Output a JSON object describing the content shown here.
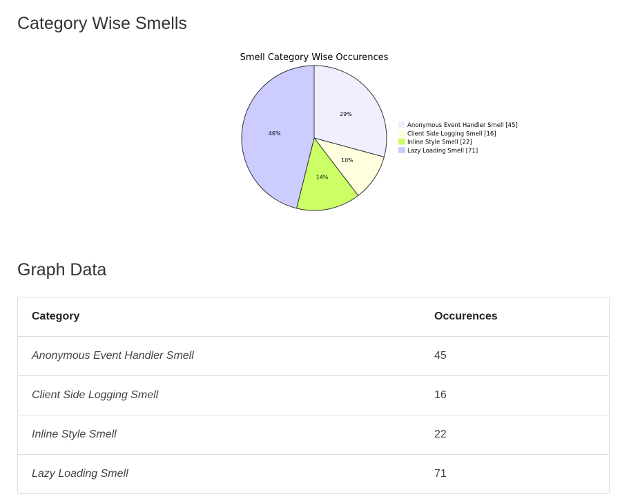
{
  "sections": {
    "chart_heading": "Category Wise Smells",
    "table_heading": "Graph Data"
  },
  "chart_data": {
    "type": "pie",
    "title": "Smell Category Wise Occurences",
    "categories": [
      "Anonymous Event Handler Smell",
      "Client Side Logging Smell",
      "Inline Style Smell",
      "Lazy Loading Smell"
    ],
    "values": [
      45,
      16,
      22,
      71
    ],
    "colors": [
      "#EFEFFF",
      "#FFFFE0",
      "#CCFF66",
      "#CCCCFF"
    ],
    "slice_labels": [
      "29%",
      "10%",
      "14%",
      "46%"
    ],
    "legend_labels": [
      "Anonymous Event Handler Smell [45]",
      "Client Side Logging Smell [16]",
      "Inline Style Smell [22]",
      "Lazy Loading Smell [71]"
    ],
    "legend_position": "right"
  },
  "table": {
    "headers": [
      "Category",
      "Occurences"
    ],
    "rows": [
      [
        "Anonymous Event Handler Smell",
        "45"
      ],
      [
        "Client Side Logging Smell",
        "16"
      ],
      [
        "Inline Style Smell",
        "22"
      ],
      [
        "Lazy Loading Smell",
        "71"
      ]
    ]
  }
}
